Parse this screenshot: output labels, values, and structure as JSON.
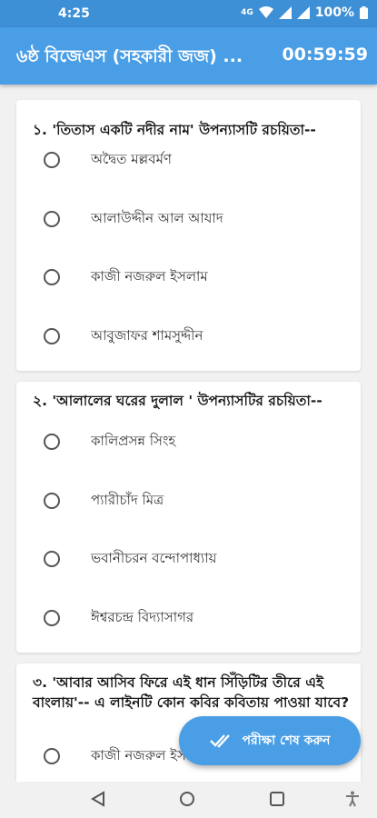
{
  "status_bar": {
    "time": "4:25",
    "network": "4G",
    "battery": "100%",
    "icons": [
      "4g-icon",
      "wifi-icon",
      "signal-icon",
      "signal-icon",
      "battery-icon"
    ]
  },
  "app_bar": {
    "title": "৬ষ্ঠ বিজেএস (সহকারী জজ) ...",
    "timer": "00:59:59"
  },
  "questions": [
    {
      "text": "১. 'তিতাস একটি নদীর নাম' উপন্যাসটি রচয়িতা--",
      "options": [
        "অদ্বৈত মল্লবর্মণ",
        "আলাউদ্দীন আল আযাদ",
        "কাজী নজরুল ইসলাম",
        "আবুজাফর শামসুদ্দীন"
      ]
    },
    {
      "text": "২. 'আলালের ঘরের দুলাল ' উপন্যাসটির রচয়িতা--",
      "options": [
        "কালিপ্রসন্ন সিংহ",
        "প্যারীচাঁদ মিত্র",
        "ভবানীচরন বন্দোপাধ্যায়",
        "ঈশ্বরচন্দ্র বিদ্যাসাগর"
      ]
    },
    {
      "text": "৩. 'আবার আসিব ফিরে এই ধান সিঁড়িটির তীরে এই বাংলায়'-- এ লাইনটি কোন কবির কবিতায় পাওয়া যাবে?",
      "options": [
        "কাজী নজরুল ইসলাম"
      ]
    }
  ],
  "fab": {
    "label": "পরীক্ষা শেষ করুন",
    "icon": "double-check-icon"
  },
  "nav_bar": {
    "icons": [
      "back-icon",
      "home-icon",
      "recents-icon",
      "accessibility-icon"
    ]
  },
  "colors": {
    "primary": "#4a9ee6",
    "status_bar": "#3d8fd6",
    "background": "#f1f1f1"
  }
}
